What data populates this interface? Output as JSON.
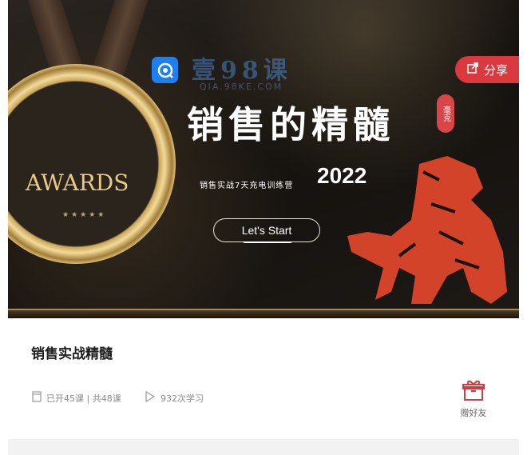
{
  "banner": {
    "medal_text": "AWARDS",
    "medal_stars": "★★★★★",
    "watermark": "壹98课",
    "watermark_sub": "QIA.98KE.COM",
    "headline": "销售的精髓",
    "seal": "毫克",
    "subtitle": "销售实战7天充电训练营",
    "year": "2022",
    "start_label": "Let's Start"
  },
  "share": {
    "label": "分享",
    "icon": "share-icon"
  },
  "course": {
    "title": "销售实战精髓",
    "lessons_text": "已开45课 | 共48课",
    "plays_text": "932次学习"
  },
  "gift": {
    "label": "赠好友",
    "icon": "gift-icon"
  },
  "colors": {
    "accent": "#d9393f",
    "logo_blue": "#1d7ff0"
  }
}
